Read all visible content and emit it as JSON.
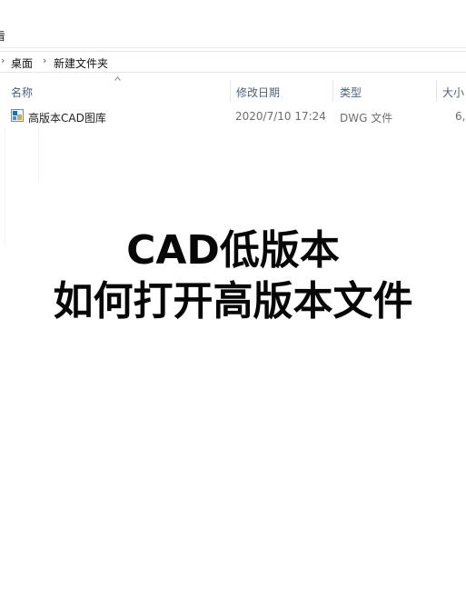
{
  "menu": {
    "partial_label": "看"
  },
  "address_bar": {
    "separator": "›",
    "breadcrumbs": [
      "桌面",
      "新建文件夹"
    ]
  },
  "columns": {
    "name": "名称",
    "date_modified": "修改日期",
    "type": "类型",
    "size": "大小"
  },
  "files": [
    {
      "name": "高版本CAD图库",
      "date_modified": "2020/7/10 17:24",
      "type": "DWG 文件",
      "size": "6,"
    }
  ],
  "overlay": {
    "line1": "CAD低版本",
    "line2": "如何打开高版本文件"
  },
  "icons": {
    "file": "dwg-file-icon",
    "sort": "sort-ascending-icon"
  },
  "colors": {
    "header_text": "#4d6082",
    "caption_text": "#070707"
  }
}
